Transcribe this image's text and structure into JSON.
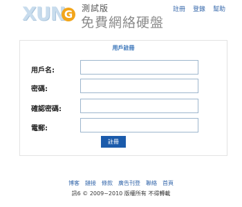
{
  "header": {
    "logo_text": "XUN",
    "logo_badge": "G",
    "edition": "測試版",
    "subtitle": "免費網絡硬盤",
    "links": [
      "註冊",
      "登錄",
      "幫助"
    ]
  },
  "register": {
    "title": "用戶註冊",
    "fields": [
      {
        "label": "用戶名:",
        "value": "",
        "placeholder": ""
      },
      {
        "label": "密碼:",
        "value": "",
        "placeholder": ""
      },
      {
        "label": "確認密碼:",
        "value": "",
        "placeholder": ""
      },
      {
        "label": "電郵:",
        "value": "",
        "placeholder": ""
      }
    ],
    "submit_label": "註冊"
  },
  "footer": {
    "links": [
      "博客",
      "鏈接",
      "條款",
      "廣告刊登",
      "聯絡",
      "首頁"
    ],
    "copyright": "訊6 © 2009~2010 版權所有 不得轉載"
  },
  "colors": {
    "link": "#3366aa",
    "button": "#1b5bab",
    "title": "#2d6cb5",
    "badge": "#f2a51a"
  }
}
